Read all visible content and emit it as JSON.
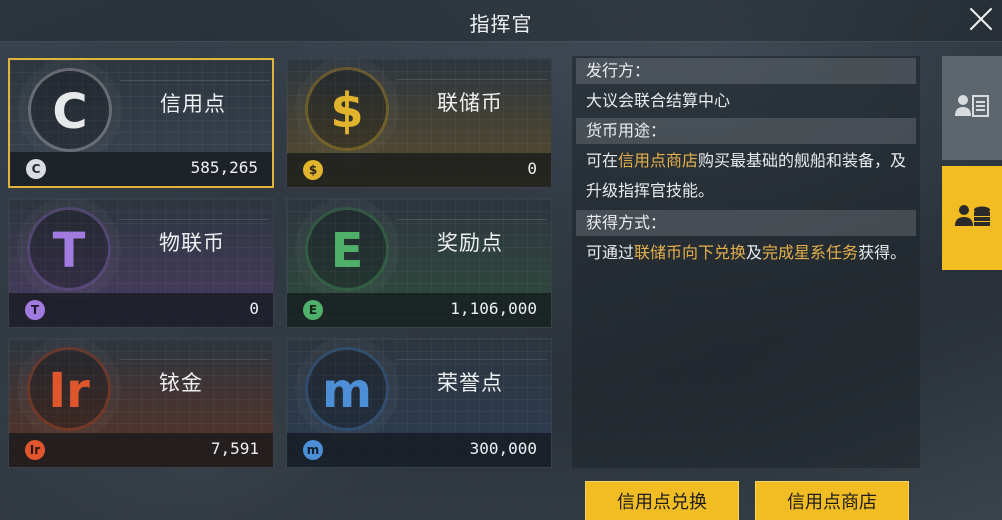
{
  "header": {
    "title": "指挥官"
  },
  "currencies": [
    {
      "name": "信用点",
      "amount": "585,265",
      "glyph": "C",
      "icon": "credit-icon",
      "color": "#e6e8ea",
      "mini_bg": "#d9dde1",
      "mini_fg": "#23282d",
      "tint": "#3a4350",
      "selected": true
    },
    {
      "name": "联储币",
      "amount": "0",
      "glyph": "$",
      "icon": "federal-coin-icon",
      "color": "#e2b42e",
      "mini_bg": "#e2b42e",
      "mini_fg": "#2a2414",
      "tint": "#5a4e2c",
      "selected": false
    },
    {
      "name": "物联币",
      "amount": "0",
      "glyph": "T",
      "icon": "iot-coin-icon",
      "color": "#a27be0",
      "mini_bg": "#a27be0",
      "mini_fg": "#21192e",
      "tint": "#4b3d63",
      "selected": false
    },
    {
      "name": "奖励点",
      "amount": "1,106,000",
      "glyph": "E",
      "icon": "reward-point-icon",
      "color": "#4fb06a",
      "mini_bg": "#4fb06a",
      "mini_fg": "#13261a",
      "tint": "#2f4d3d",
      "selected": false
    },
    {
      "name": "铱金",
      "amount": "7,591",
      "glyph": "Ir",
      "icon": "iridium-icon",
      "color": "#e0562c",
      "mini_bg": "#e0562c",
      "mini_fg": "#2a140c",
      "tint": "#5b3326",
      "selected": false
    },
    {
      "name": "荣誉点",
      "amount": "300,000",
      "glyph": "m",
      "icon": "honor-point-icon",
      "color": "#4d8fd6",
      "mini_bg": "#4d8fd6",
      "mini_fg": "#101c2a",
      "tint": "#2c3d55",
      "selected": false
    }
  ],
  "info": {
    "issuer_label": "发行方：",
    "issuer_value": "大议会联合结算中心",
    "usage_label": "货币用途：",
    "usage_pre": "可在",
    "usage_link": "信用点商店",
    "usage_post": "购买最基础的舰船和装备，及升级指挥官技能。",
    "obtain_label": "获得方式：",
    "obtain_pre": "可通过",
    "obtain_link1": "联储币向下兑换",
    "obtain_mid": "及",
    "obtain_link2": "完成星系任务",
    "obtain_post": "获得。"
  },
  "side_tabs": [
    {
      "icon": "profile-list-icon",
      "active": false
    },
    {
      "icon": "currency-stack-icon",
      "active": true
    }
  ],
  "buttons": {
    "exchange": "信用点兑换",
    "shop": "信用点商店"
  },
  "colors": {
    "accent": "#f2bd23",
    "highlight": "#e5b04a"
  }
}
